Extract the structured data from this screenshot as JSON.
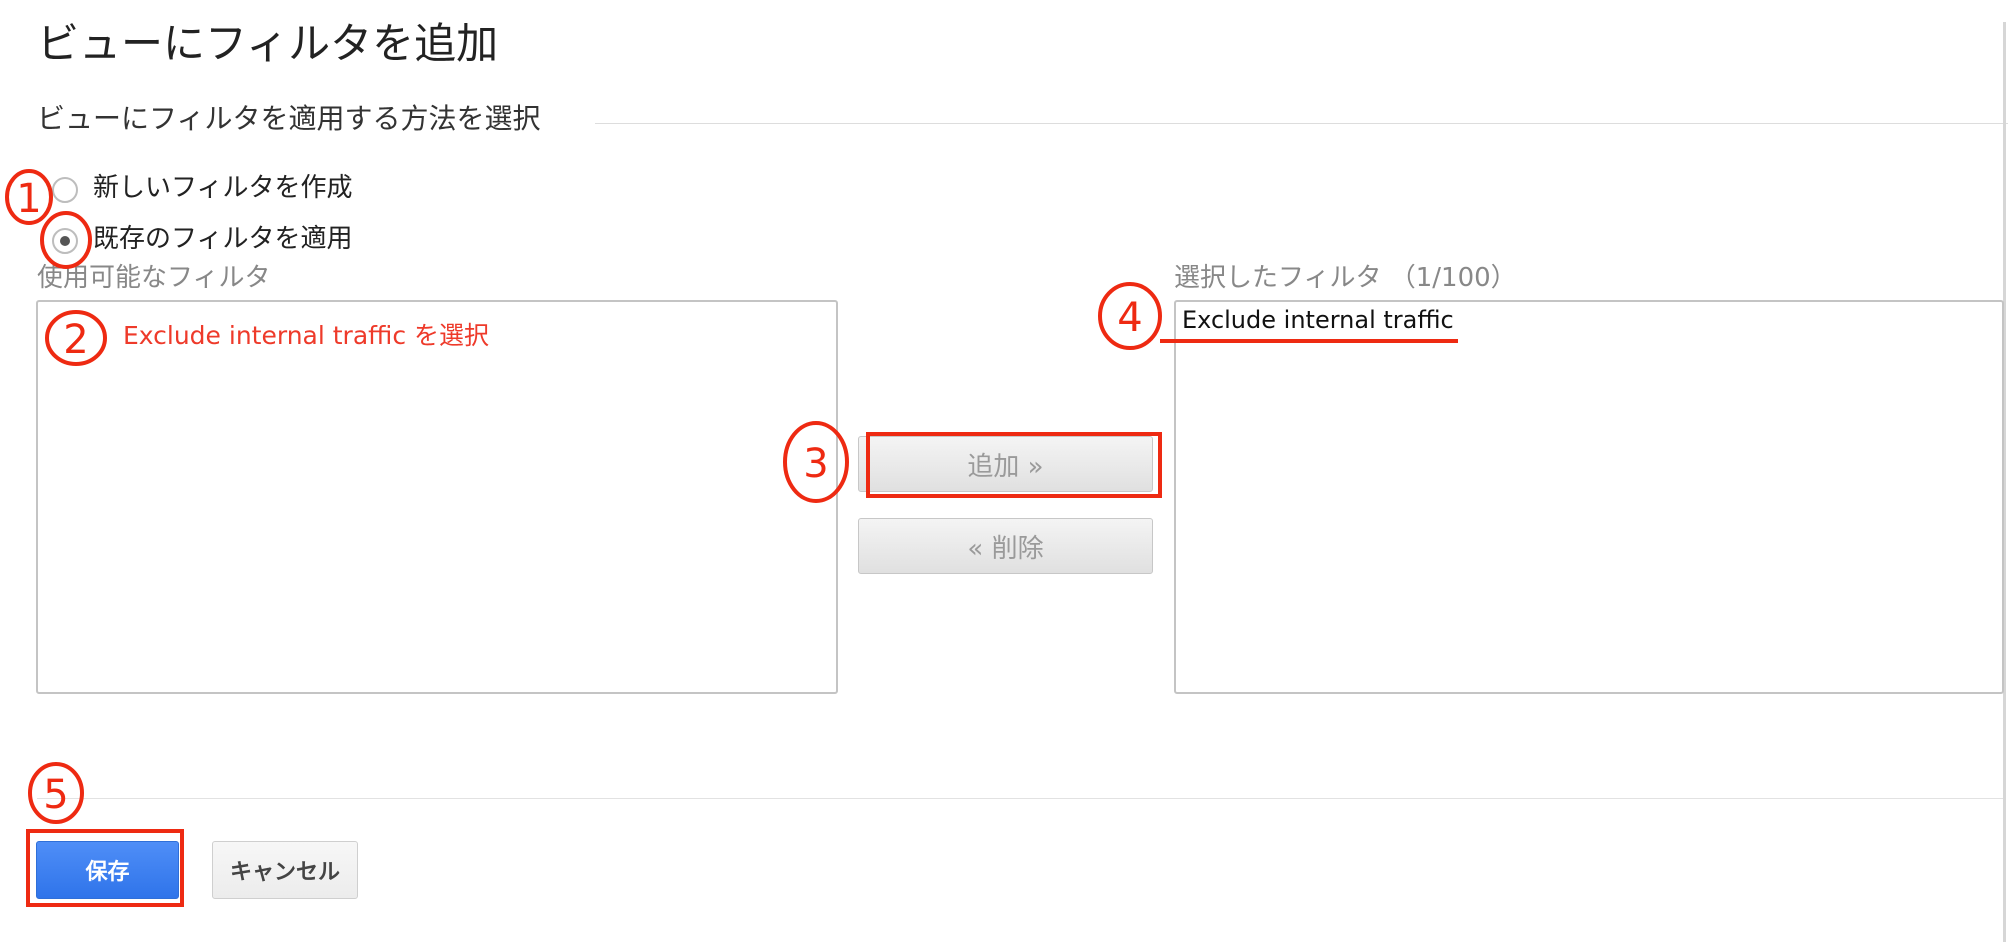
{
  "page_title": "ビューにフィルタを追加",
  "section_title": "ビューにフィルタを適用する方法を選択",
  "options": {
    "create_new": {
      "label": "新しいフィルタを作成",
      "selected": false
    },
    "apply_existing": {
      "label": "既存のフィルタを適用",
      "selected": true
    }
  },
  "available": {
    "caption": "使用可能なフィルタ",
    "items": []
  },
  "selected": {
    "caption": "選択したフィルタ （1/100）",
    "items": [
      "Exclude internal traffic"
    ]
  },
  "buttons": {
    "add": "追加 »",
    "remove": "« 削除",
    "save": "保存",
    "cancel": "キャンセル"
  },
  "annotations": {
    "note_2": "Exclude internal traffic を選択",
    "step_numbers": [
      "1",
      "2",
      "3",
      "4",
      "5"
    ],
    "color": "#ee2a12"
  },
  "colors": {
    "primary_button": "#3a7ff0",
    "annotation": "#ee2a12"
  }
}
